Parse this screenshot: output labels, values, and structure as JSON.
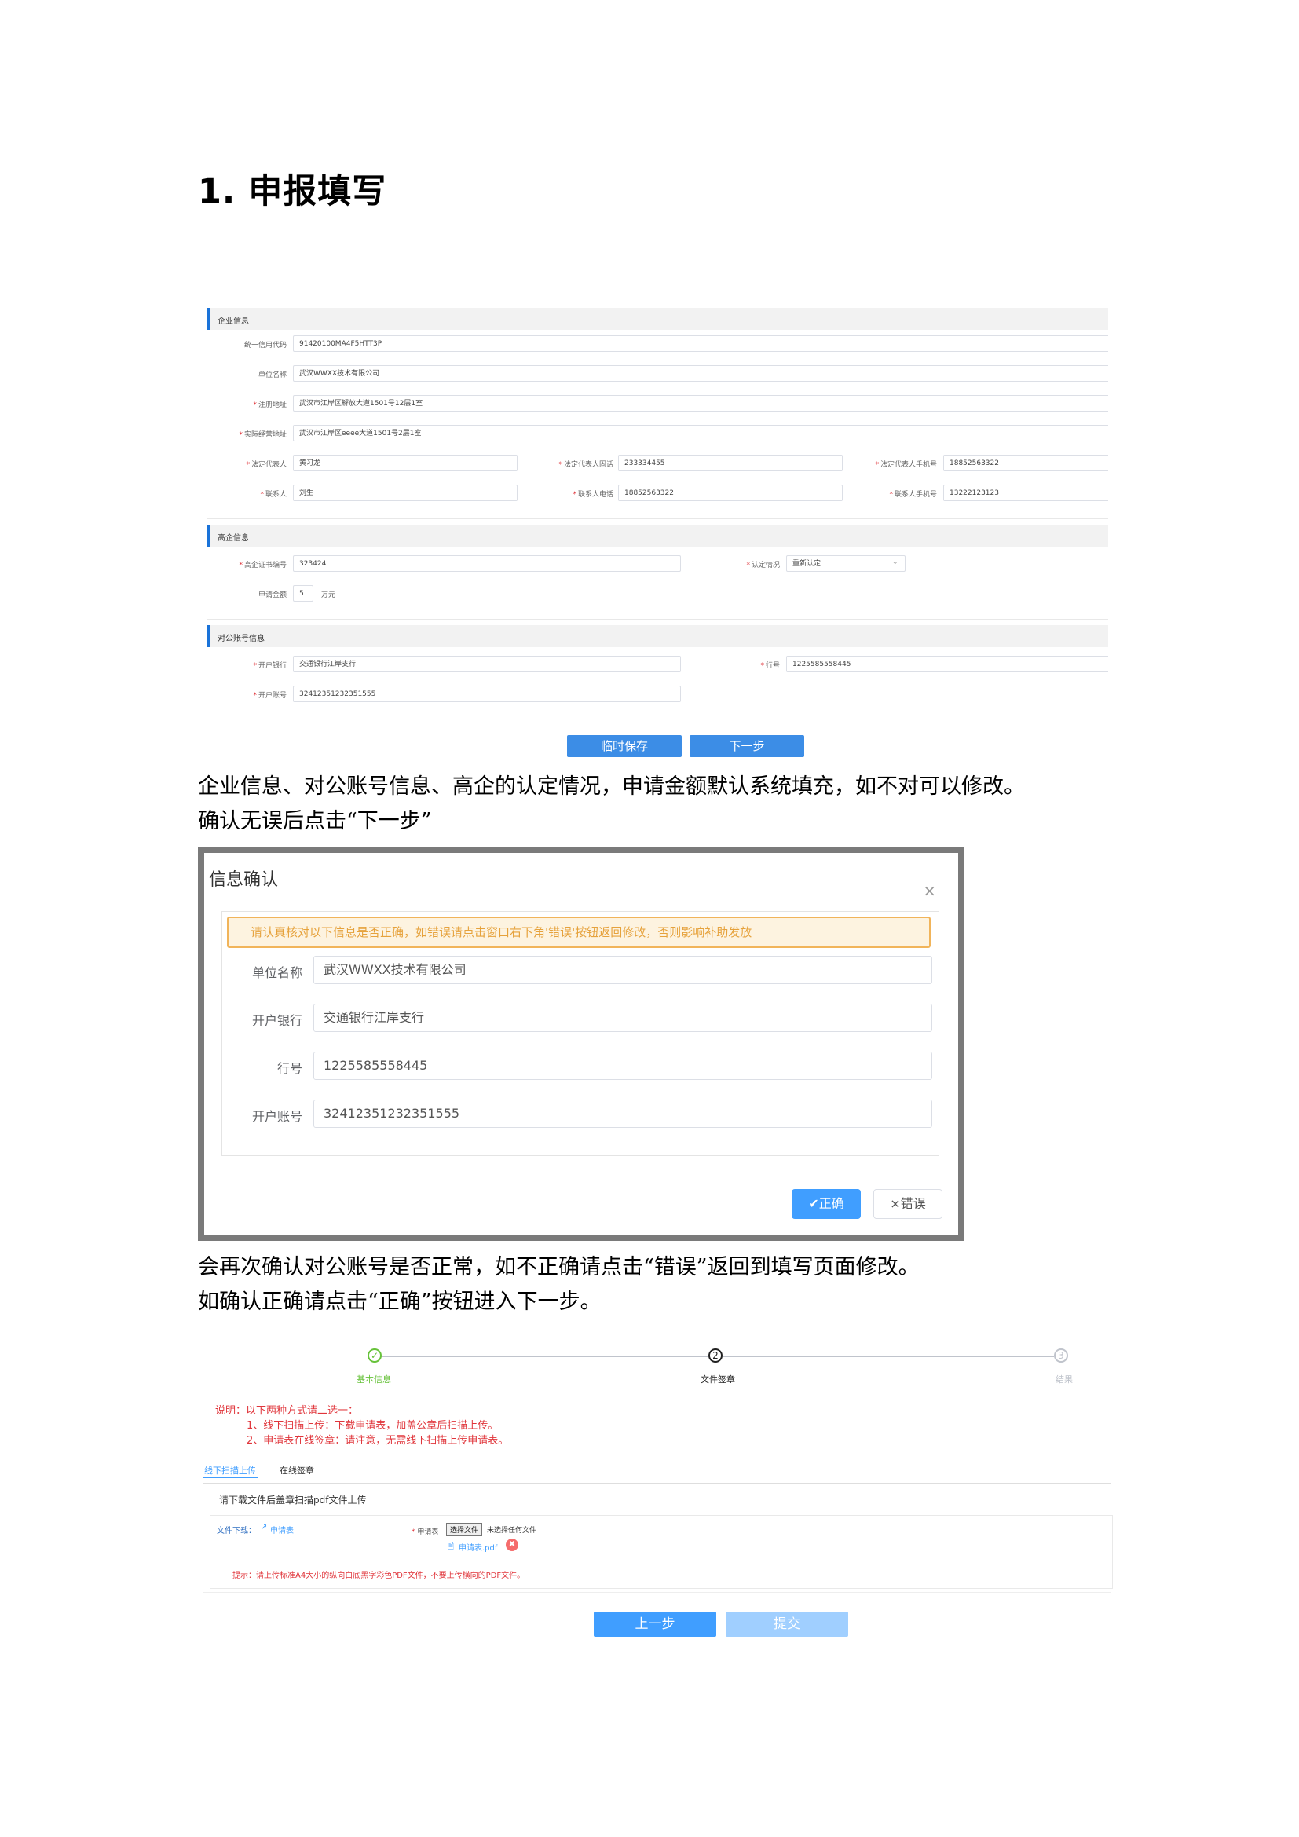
{
  "heading": "1. 申报填写",
  "form": {
    "sections": {
      "company": "企业信息",
      "hightech": "高企信息",
      "account": "对公账号信息"
    },
    "fields": {
      "credit_code": {
        "label": "统一信用代码",
        "value": "91420100MA4F5HTT3P"
      },
      "unit_name": {
        "label": "单位名称",
        "value": "武汉WWXX技术有限公司"
      },
      "reg_addr": {
        "label": "注册地址",
        "value": "武汉市江岸区解放大道1501号12层1室"
      },
      "real_addr": {
        "label": "实际经营地址",
        "value": "武汉市江岸区eeee大道1501号2层1室"
      },
      "legal_rep": {
        "label": "法定代表人",
        "value": "黄习龙"
      },
      "legal_tel": {
        "label": "法定代表人固话",
        "value": "233334455"
      },
      "legal_mobile": {
        "label": "法定代表人手机号",
        "value": "18852563322"
      },
      "contact": {
        "label": "联系人",
        "value": "刘生"
      },
      "contact_tel": {
        "label": "联系人电话",
        "value": "18852563322"
      },
      "contact_mobile": {
        "label": "联系人手机号",
        "value": "13222123123"
      },
      "cert_no": {
        "label": "高企证书编号",
        "value": "323424"
      },
      "recognition": {
        "label": "认定情况",
        "value": "重新认定"
      },
      "amount": {
        "label": "申请金额",
        "value": "5",
        "unit": "万元"
      },
      "bank": {
        "label": "开户银行",
        "value": "交通银行江岸支行"
      },
      "bank_code": {
        "label": "行号",
        "value": "1225585558445"
      },
      "account_no": {
        "label": "开户账号",
        "value": "32412351232351555"
      }
    },
    "buttons": {
      "save": "临时保存",
      "next": "下一步"
    }
  },
  "para1": {
    "line1": "企业信息、对公账号信息、高企的认定情况，申请金额默认系统填充，如不对可以修改。",
    "line2": "确认无误后点击“下一步”"
  },
  "dialog": {
    "title": "信息确认",
    "close": "×",
    "warning": "请认真核对以下信息是否正确，如错误请点击窗口右下角'错误'按钮返回修改，否则影响补助发放",
    "rows": [
      {
        "label": "单位名称",
        "value": "武汉WWXX技术有限公司"
      },
      {
        "label": "开户银行",
        "value": "交通银行江岸支行"
      },
      {
        "label": "行号",
        "value": "1225585558445"
      },
      {
        "label": "开户账号",
        "value": "32412351232351555"
      }
    ],
    "ok": "✔正确",
    "err": "×错误"
  },
  "para2": {
    "line1": "会再次确认对公账号是否正常，如不正确请点击“错误”返回到填写页面修改。",
    "line2": "如确认正确请点击“正确”按钮进入下一步。"
  },
  "upload": {
    "steps": [
      {
        "num": "✓",
        "label": "基本信息"
      },
      {
        "num": "2",
        "label": "文件签章"
      },
      {
        "num": "3",
        "label": "结果"
      }
    ],
    "note_title": "说明：以下两种方式请二选一：",
    "note_1": "1、线下扫描上传：下载申请表，加盖公章后扫描上传。",
    "note_2": "2、申请表在线签章：请注意，无需线下扫描上传申请表。",
    "tabs": [
      "线下扫描上传",
      "在线签章"
    ],
    "panel_title": "请下载文件后盖章扫描pdf文件上传",
    "download_label": "文件下载：",
    "download_link": "申请表",
    "file_label": "申请表",
    "choose_btn": "选择文件",
    "no_file": "未选择任何文件",
    "uploaded_file": "申请表.pdf",
    "tip": "提示：请上传标准A4大小的纵向白底黑字彩色PDF文件，不要上传横向的PDF文件。",
    "buttons": {
      "prev": "上一步",
      "submit": "提交"
    }
  },
  "colors": {
    "primary": "#409eff",
    "warning_bg": "#fdf3e0",
    "warning_text": "#e6a23c",
    "error": "#e0353b",
    "success": "#67c23a"
  }
}
